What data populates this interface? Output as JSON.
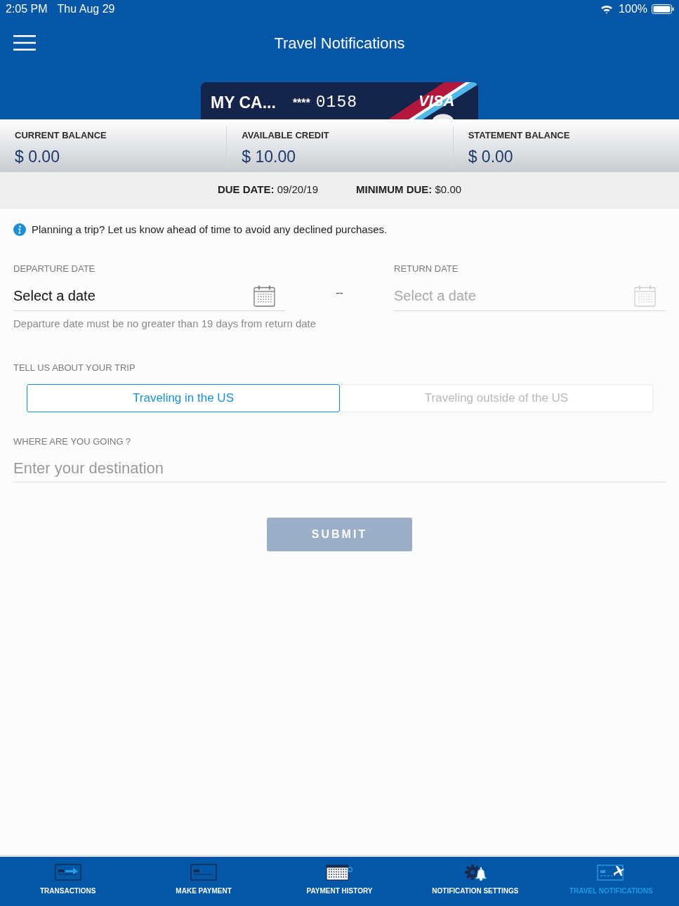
{
  "status_bar": {
    "time": "2:05 PM",
    "date": "Thu Aug 29",
    "battery": "100%"
  },
  "header": {
    "title": "Travel Notifications"
  },
  "card": {
    "name": "MY CA...",
    "mask": "****",
    "last_digits": "0158",
    "network": "VISA"
  },
  "balances": [
    {
      "label": "CURRENT BALANCE",
      "amount": "$ 0.00"
    },
    {
      "label": "AVAILABLE CREDIT",
      "amount": "$ 10.00"
    },
    {
      "label": "STATEMENT BALANCE",
      "amount": "$ 0.00"
    }
  ],
  "due": [
    {
      "text": "**DUE DATE:** 09/20/19"
    },
    {
      "text": "**MINIMUM DUE:** $0.00"
    }
  ],
  "info": "Planning a trip? Let us know ahead of time to avoid any declined purchases.",
  "trip_dates": {
    "fields": [
      {
        "label": "DEPARTURE DATE",
        "placeholder": "Select a date",
        "disabled": false,
        "hint": "Departure date must be no greater than 19 days from return date"
      },
      {
        "label": "RETURN DATE",
        "placeholder": "Select a date",
        "disabled": true
      }
    ],
    "separator": "--"
  },
  "trip_type": {
    "label": "TELL US ABOUT YOUR TRIP",
    "options": [
      {
        "label": "Traveling in the US",
        "selected": true
      },
      {
        "label": "Traveling outside of the US",
        "selected": false
      }
    ]
  },
  "destination": {
    "label": "WHERE ARE YOU GOING ?",
    "placeholder": "Enter your destination"
  },
  "submit": {
    "label": "SUBMIT",
    "disabled": true
  },
  "tab_bar": [
    {
      "label": "TRANSACTIONS",
      "kind": "transactions",
      "selected": false
    },
    {
      "label": "MAKE PAYMENT",
      "kind": "payment",
      "selected": false
    },
    {
      "label": "PAYMENT HISTORY",
      "kind": "history",
      "selected": false
    },
    {
      "label": "NOTIFICATION SETTINGS",
      "kind": "settings",
      "selected": false
    },
    {
      "label": "TRAVEL NOTIFICATIONS",
      "kind": "travel",
      "selected": true
    }
  ]
}
